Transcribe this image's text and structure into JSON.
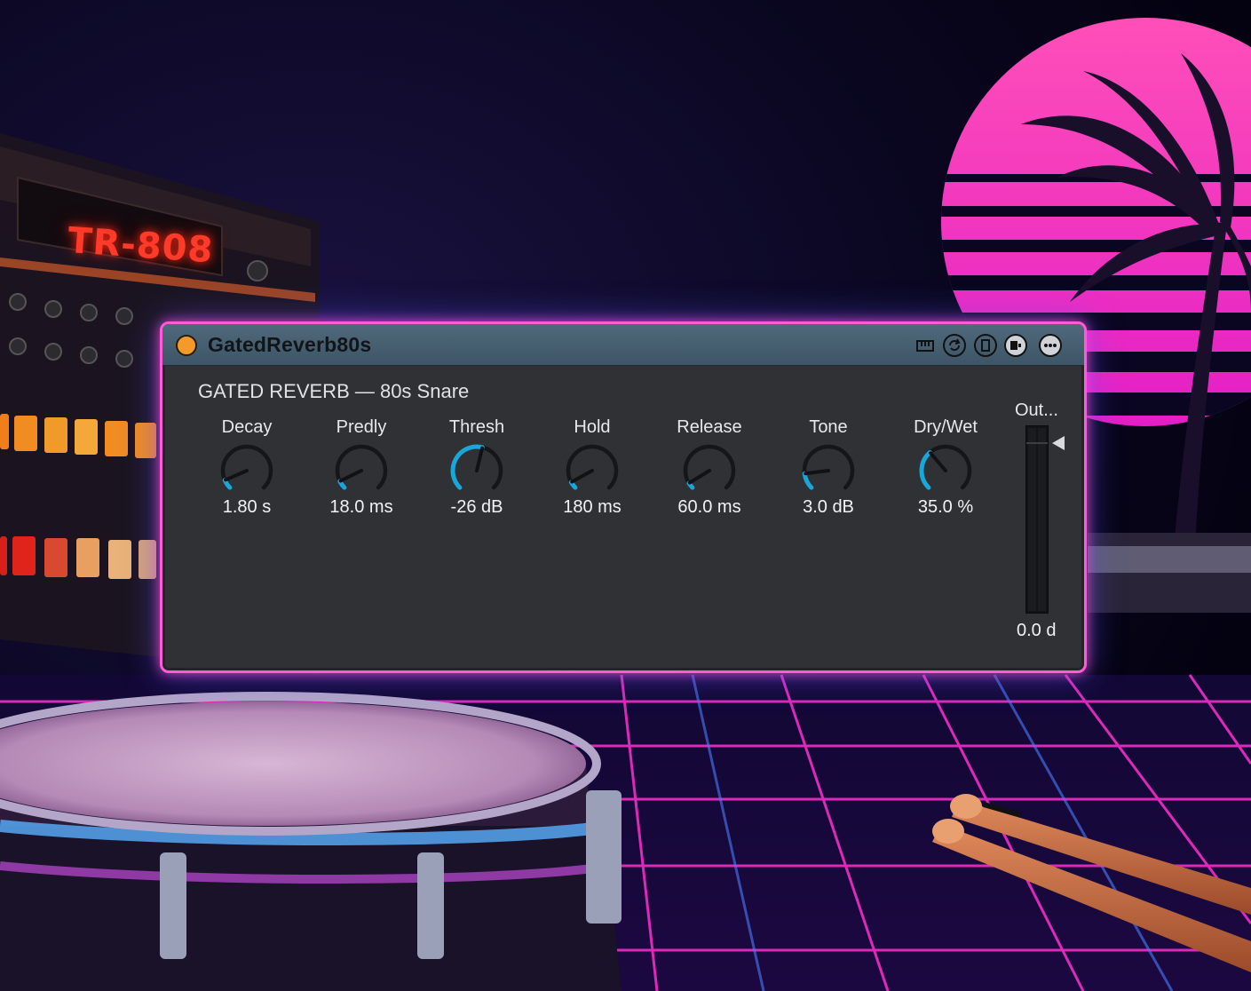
{
  "background": {
    "drum_machine_label": "TR-808",
    "colors": {
      "neon_pink": "#ff3fc8",
      "neon_blue": "#3a7bff",
      "sky": "#070418"
    }
  },
  "plugin": {
    "name": "GatedReverb80s",
    "power_on": true,
    "preset_title": "GATED REVERB — 80s Snare",
    "accent_color": "#1aa6d9",
    "title_icons": [
      "midi-keyboard-icon",
      "refresh-icon",
      "device-view-icon",
      "expand-view-icon",
      "more-options-icon"
    ],
    "knobs": [
      {
        "label": "Decay",
        "value": "1.80 s",
        "level": 0.08
      },
      {
        "label": "Predly",
        "value": "18.0 ms",
        "level": 0.07
      },
      {
        "label": "Thresh",
        "value": "-26 dB",
        "level": 0.55
      },
      {
        "label": "Hold",
        "value": "180 ms",
        "level": 0.06
      },
      {
        "label": "Release",
        "value": "60.0 ms",
        "level": 0.05
      },
      {
        "label": "Tone",
        "value": "3.0 dB",
        "level": 0.14
      },
      {
        "label": "Dry/Wet",
        "value": "35.0 %",
        "level": 0.35
      }
    ],
    "output": {
      "label": "Out...",
      "value": "0.0 d",
      "level": 0.0
    }
  }
}
